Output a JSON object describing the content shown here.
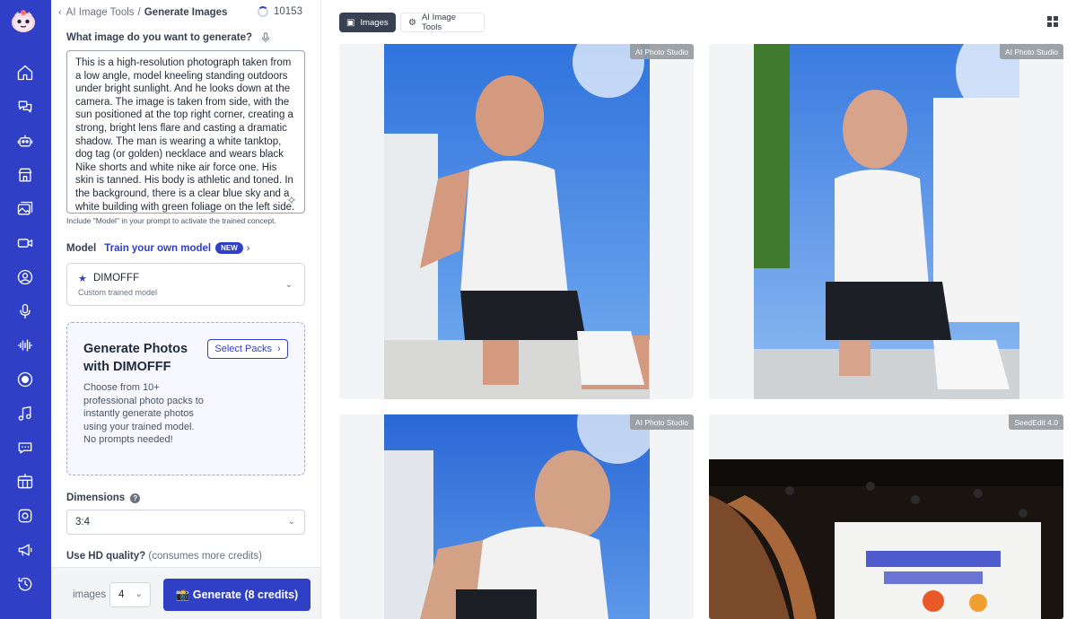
{
  "breadcrumb": {
    "parent": "AI Image Tools",
    "separator": "/",
    "current": "Generate Images"
  },
  "credits": {
    "value": "10153"
  },
  "prompt": {
    "label": "What image do you want to generate?",
    "text": "This is a high-resolution photograph taken from a low angle, model kneeling standing outdoors under bright sunlight. And he looks down at the camera. The image is taken from side, with the sun positioned at the top right corner, creating a strong, bright lens flare and casting a dramatic shadow. The man is wearing a white tanktop, dog tag (or golden) necklace and wears black Nike shorts and white nike air force one. His skin is tanned. His body is athletic and toned. In the background, there is a clear blue sky and a white building with green foliage on the left side. The",
    "hint": "Include \"Model\" in your prompt to activate the trained concept."
  },
  "model": {
    "label": "Model",
    "train_link": "Train your own model",
    "new_badge": "NEW",
    "selected_name": "DIMOFFF",
    "selected_sub": "Custom trained model"
  },
  "promo": {
    "title": "Generate Photos with DIMOFFF",
    "button": "Select Packs",
    "description": "Choose from 10+ professional photo packs to instantly generate photos using your trained model. No prompts needed!"
  },
  "dimensions": {
    "label": "Dimensions",
    "value": "3:4"
  },
  "hd": {
    "label": "Use HD quality?",
    "extra": "(consumes more credits)"
  },
  "footer": {
    "images_label": "images",
    "images_count": "4",
    "generate_label": "📸 Generate (8 credits)"
  },
  "tabs": [
    {
      "label": "Images",
      "active": true
    },
    {
      "label": "AI Image Tools",
      "active": false
    }
  ],
  "gallery": [
    {
      "badge": "AI Photo Studio",
      "alt": "generated-photo-1"
    },
    {
      "badge": "AI Photo Studio",
      "alt": "generated-photo-2"
    },
    {
      "badge": "AI Photo Studio",
      "alt": "generated-photo-3"
    },
    {
      "badge": "SeedEdit 4.0",
      "alt": "generated-photo-4"
    }
  ],
  "colors": {
    "accent": "#2f3fc6",
    "sky": "#3d82e6",
    "dark_tab": "#374151"
  },
  "icons": [
    "home-icon",
    "chat-icon",
    "robot-icon",
    "store-icon",
    "images-icon",
    "video-icon",
    "avatar-icon",
    "microphone-icon",
    "waveform-icon",
    "record-icon",
    "music-icon",
    "chat-bubble-icon",
    "grid-add-icon",
    "camera-icon",
    "megaphone-icon",
    "history-icon"
  ]
}
